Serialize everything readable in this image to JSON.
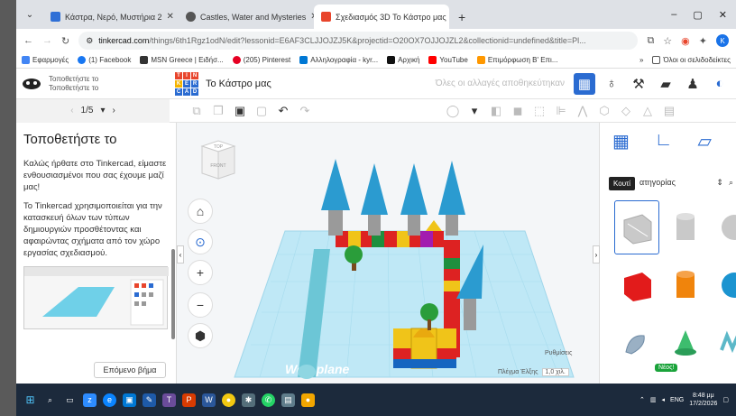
{
  "browser": {
    "tabs": [
      {
        "title": "Κάστρα, Νερό, Μυστήρια 2",
        "color": "#2f6fd6",
        "active": false
      },
      {
        "title": "Castles, Water and Mysteries",
        "color": "#555555",
        "active": false
      },
      {
        "title": "Σχεδιασμός 3D Το Κάστρο μας",
        "color": "#e8452c",
        "active": true
      }
    ],
    "new_tab_label": "+",
    "window_controls": [
      "–",
      "▢",
      "✕"
    ],
    "url_host": "tinkercad.com",
    "url_path": "/things/6th1Rgz1odN/edit?lessonid=E6AF3CLJJOJZJ5K&projectid=O20OX7OJJOJZL2&collectionid=undefined&title=Pl...",
    "bookmarks": [
      {
        "label": "Εφαρμογές",
        "color": "#4285f4"
      },
      {
        "label": "(1) Facebook",
        "color": "#1877f2"
      },
      {
        "label": "MSN Greece | Ειδήσ...",
        "color": "#333333"
      },
      {
        "label": "(205) Pinterest",
        "color": "#e60023"
      },
      {
        "label": "Αλληλογραφία - kyr...",
        "color": "#0078d4"
      },
      {
        "label": "Αρχική",
        "color": "#111111"
      },
      {
        "label": "YouTube",
        "color": "#ff0000"
      },
      {
        "label": "Επιμόρφωση Β' Επι...",
        "color": "#ff9800"
      }
    ],
    "bookmarks_more": "»",
    "bookmarks_all": "Όλοι οι σελιδοδείκτες"
  },
  "tinkercad": {
    "user_line1": "Τοποθετήστε το",
    "user_line2": "Τοποθετήστε το",
    "logo_letters": [
      "T",
      "I",
      "N",
      "K",
      "E",
      "R",
      "C",
      "A",
      "D"
    ],
    "project_name": "Το Κάστρο μας",
    "saved_message": "Όλες οι αλλαγές αποθηκεύτηκαν",
    "step_label": "1/5",
    "lesson": {
      "title": "Τοποθετήστε το",
      "para1": "Καλώς ήρθατε στο Tinkercad, είμαστε ενθουσιασμένοι που σας έχουμε μαζί μας!",
      "para2": "Το Tinkercad χρησιμοποιείται για την κατασκευή όλων των τύπων δημιουργιών προσθέτοντας και αφαιρώντας σχήματα από τον χώρο εργασίας σχεδιασμού.",
      "next_button": "Επόμενο βήμα"
    },
    "viewcube_top": "TOP",
    "viewcube_front": "FRONT",
    "workplane_label": "Workplane",
    "settings_label": "Ρυθμίσεις",
    "grid_label": "Πλέγμα Έλξης",
    "grid_value": "1,0 χιλ.",
    "category_label": "ατηγορίας",
    "tooltip": "Κουτί",
    "new_badge": "Νέος!"
  },
  "taskbar": {
    "lang": "ENG",
    "time": "8:48 μμ",
    "date": "17/2/2026"
  }
}
